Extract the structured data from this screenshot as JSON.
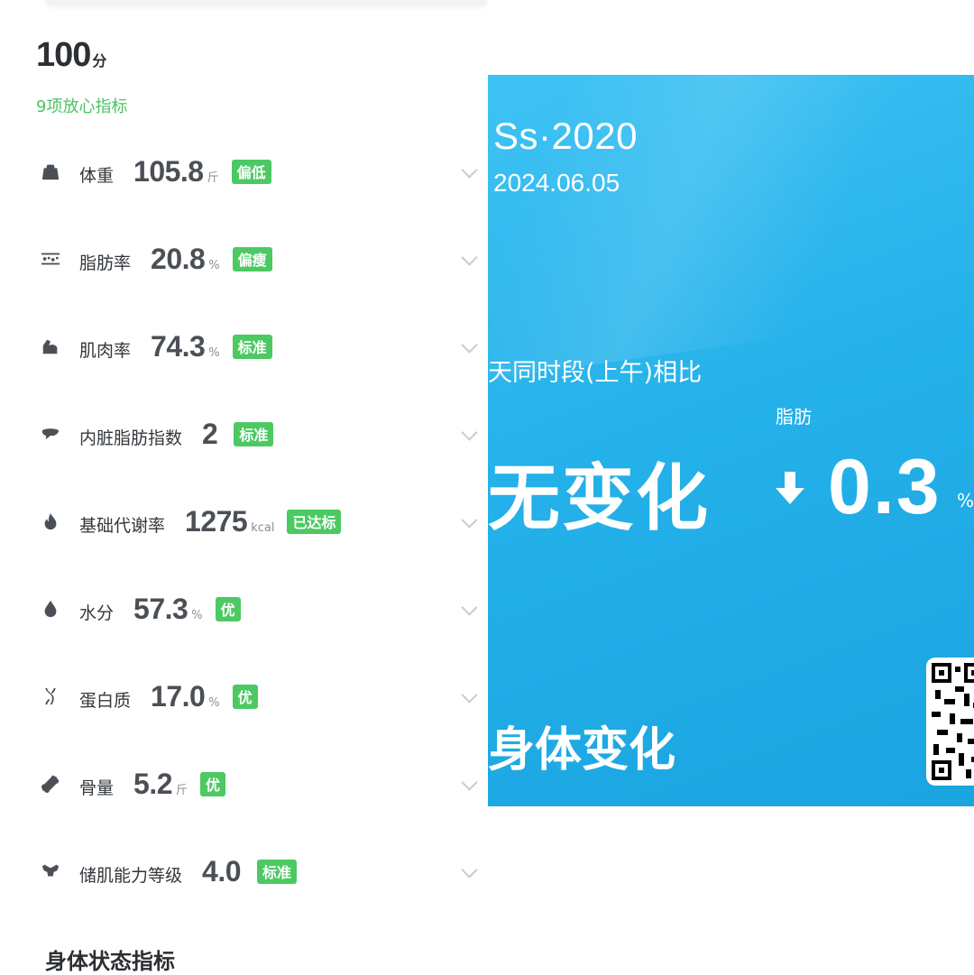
{
  "score": {
    "value": "100",
    "unit": "分"
  },
  "safe_indicators_label": "9项放心指标",
  "metrics": [
    {
      "icon": "weight-icon",
      "label": "体重",
      "value": "105.8",
      "unit": "斤",
      "badge": "偏低"
    },
    {
      "icon": "body-fat-icon",
      "label": "脂肪率",
      "value": "20.8",
      "unit": "%",
      "badge": "偏瘦"
    },
    {
      "icon": "muscle-icon",
      "label": "肌肉率",
      "value": "74.3",
      "unit": "%",
      "badge": "标准"
    },
    {
      "icon": "visceral-fat-icon",
      "label": "内脏脂肪指数",
      "value": "2",
      "unit": "",
      "badge": "标准"
    },
    {
      "icon": "flame-icon",
      "label": "基础代谢率",
      "value": "1275",
      "unit": "kcal",
      "badge": "已达标"
    },
    {
      "icon": "water-drop-icon",
      "label": "水分",
      "value": "57.3",
      "unit": "%",
      "badge": "优"
    },
    {
      "icon": "dna-icon",
      "label": "蛋白质",
      "value": "17.0",
      "unit": "%",
      "badge": "优"
    },
    {
      "icon": "bone-icon",
      "label": "骨量",
      "value": "5.2",
      "unit": "斤",
      "badge": "优"
    },
    {
      "icon": "muscle-strength-icon",
      "label": "储肌能力等级",
      "value": "4.0",
      "unit": "",
      "badge": "标准"
    }
  ],
  "section_title": "身体状态指标",
  "card": {
    "user": "Ss·2020",
    "date": "2024.06.05",
    "compare_text": "天同时段(上午)相比",
    "fat_label": "脂肪",
    "weight_change": "无变化",
    "fat_change_value": "0.3",
    "fat_change_unit": "%",
    "footer_title": "身体变化"
  },
  "colors": {
    "badge": "#4cc962",
    "safe_label": "#4cc261",
    "card_blue": "#25b1ea"
  }
}
